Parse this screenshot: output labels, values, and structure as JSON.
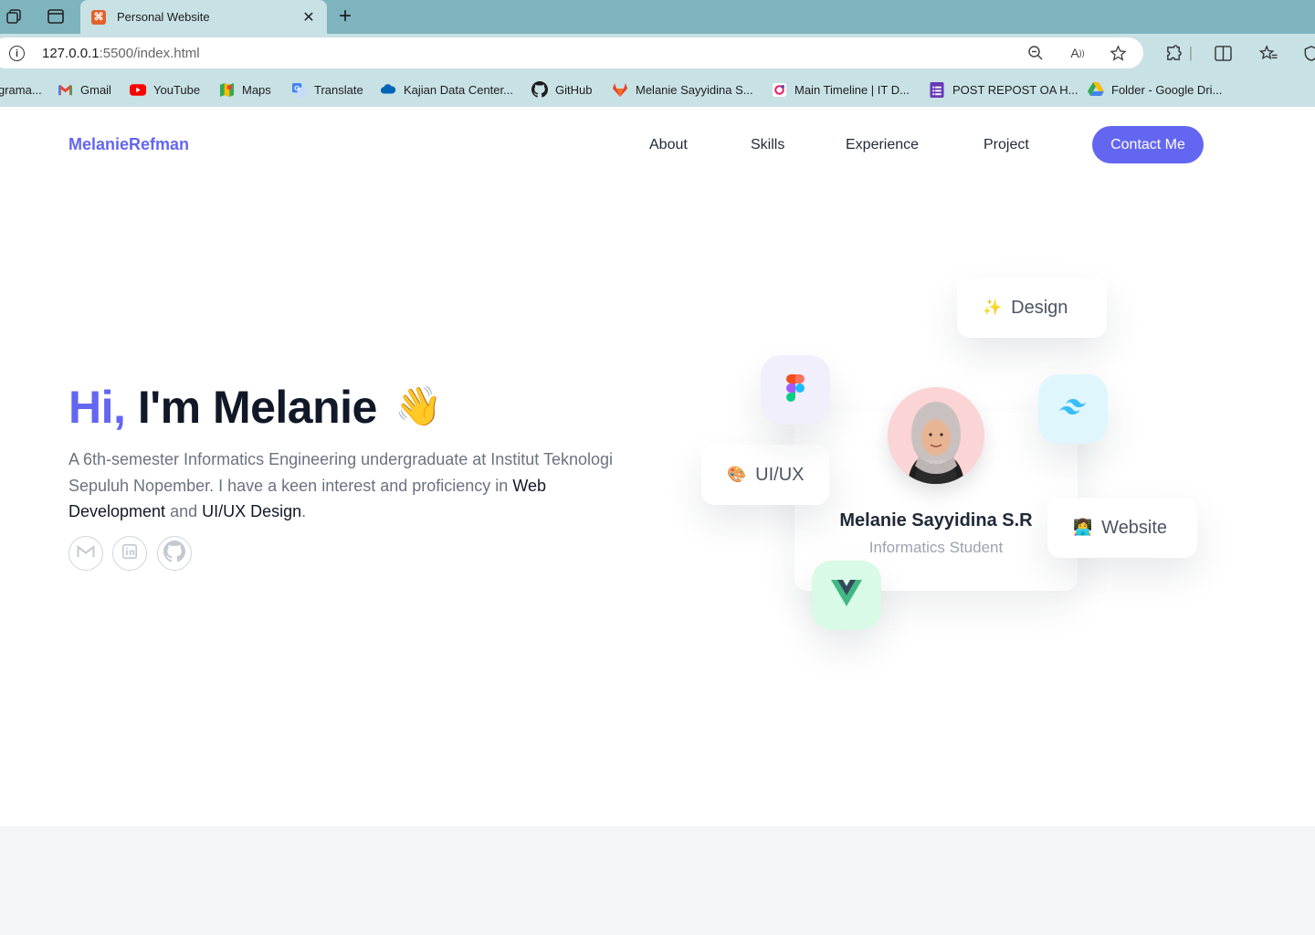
{
  "browser": {
    "tab_title": "Personal Website",
    "url_host": "127.0.0.1",
    "url_path": ":5500/index.html",
    "bookmarks": [
      {
        "label": "grama...",
        "icon": "folder-icon"
      },
      {
        "label": "Gmail",
        "icon": "gmail-icon"
      },
      {
        "label": "YouTube",
        "icon": "youtube-icon"
      },
      {
        "label": "Maps",
        "icon": "maps-icon"
      },
      {
        "label": "Translate",
        "icon": "translate-icon"
      },
      {
        "label": "Kajian Data Center...",
        "icon": "cloud-icon"
      },
      {
        "label": "GitHub",
        "icon": "github-icon"
      },
      {
        "label": "Melanie Sayyidina S...",
        "icon": "gitlab-icon"
      },
      {
        "label": "Main Timeline | IT D...",
        "icon": "timeline-icon"
      },
      {
        "label": "POST REPOST OA H...",
        "icon": "forms-icon"
      },
      {
        "label": "Folder - Google Dri...",
        "icon": "drive-icon"
      }
    ]
  },
  "site": {
    "logo": "MelanieRefman",
    "nav": [
      "About",
      "Skills",
      "Experience",
      "Project"
    ],
    "contact_label": "Contact Me",
    "accent": "#6366f1"
  },
  "hero": {
    "greeting": "Hi,",
    "name_line": "I'm Melanie",
    "wave": "👋",
    "desc_1": "A 6th-semester Informatics Engineering undergraduate at Institut Teknologi Sepuluh Nopember. I have a keen interest and proficiency in ",
    "desc_web": "Web Development",
    "desc_and": " and ",
    "desc_uiux": "UI/UX Design",
    "desc_end": ".",
    "socials": [
      "gmail-icon",
      "linkedin-icon",
      "github-icon"
    ]
  },
  "profile": {
    "name": "Melanie Sayyidina S.R",
    "role": "Informatics Student"
  },
  "chips": {
    "design": {
      "emoji": "✨",
      "label": "Design"
    },
    "uiux": {
      "emoji": "🎨",
      "label": "UI/UX"
    },
    "website": {
      "emoji": "👩‍💻",
      "label": "Website"
    }
  }
}
